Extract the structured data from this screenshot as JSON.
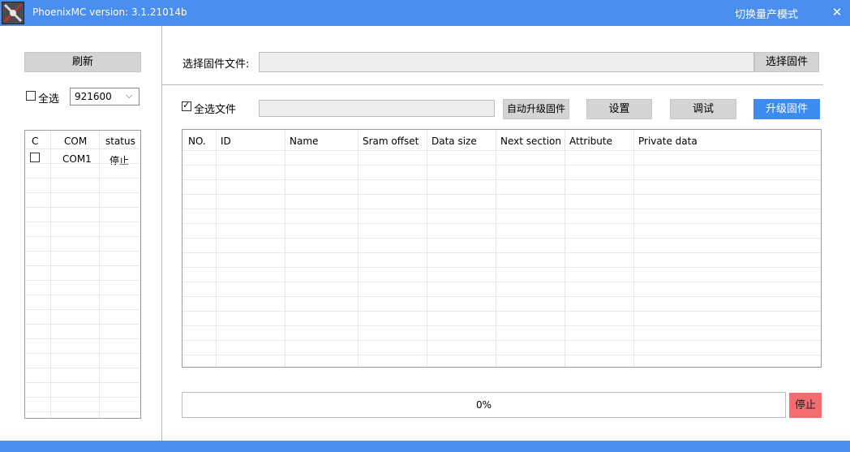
{
  "window": {
    "title": "PhoenixMC version: 3.1.21014b",
    "mode_switch": "切换量产模式",
    "minimize": "_",
    "close": "✕"
  },
  "left": {
    "refresh_button": "刷新",
    "select_all_label": "全选",
    "select_all_checked": false,
    "baud_rate": "921600",
    "grid": {
      "headers": [
        "C",
        "COM",
        "status"
      ],
      "rows": [
        {
          "checked": false,
          "com": "COM1",
          "status": "停止"
        }
      ]
    }
  },
  "main": {
    "firmware_label": "选择固件文件:",
    "firmware_path": "",
    "choose_firmware_button": "选择固件",
    "select_all_files_label": "全选文件",
    "select_all_files_checked": true,
    "file_path": "",
    "auto_upgrade_button": "自动升级固件",
    "settings_button": "设置",
    "debug_button": "调试",
    "upgrade_button": "升级固件",
    "table": {
      "headers": [
        "NO.",
        "ID",
        "Name",
        "Sram offset",
        "Data size",
        "Next section",
        "Attribute",
        "Private data"
      ],
      "rows": []
    },
    "progress": {
      "value": 0,
      "text": "0%"
    },
    "stop_button": "停止"
  },
  "colors": {
    "titlebar": "#4a8ef0",
    "primary_button": "#3d8bf1",
    "stop_button": "#f26c70",
    "neutral_button": "#d4d4d4"
  }
}
